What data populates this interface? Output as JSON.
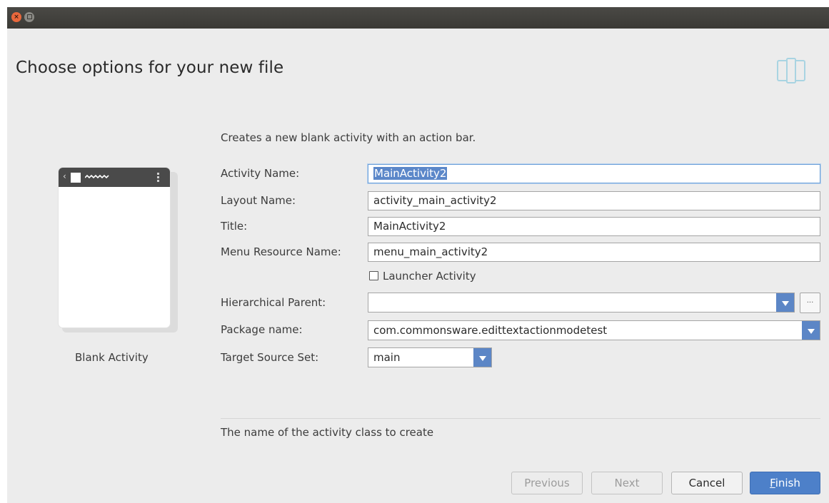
{
  "dialog": {
    "heading": "Choose options for your new file",
    "description": "Creates a new blank activity with an action bar.",
    "hint": "The name of the activity class to create"
  },
  "template": {
    "label": "Blank Activity"
  },
  "form": {
    "activity_name": {
      "label": "Activity Name:",
      "value": "MainActivity2"
    },
    "layout_name": {
      "label": "Layout Name:",
      "value": "activity_main_activity2"
    },
    "title": {
      "label": "Title:",
      "value": "MainActivity2"
    },
    "menu_resource_name": {
      "label": "Menu Resource Name:",
      "value": "menu_main_activity2"
    },
    "launcher_activity": {
      "label": "Launcher Activity",
      "checked": false
    },
    "hierarchical_parent": {
      "label": "Hierarchical Parent:",
      "value": "",
      "browse_label": "..."
    },
    "package_name": {
      "label": "Package name:",
      "value": "com.commonsware.edittextactionmodetest"
    },
    "target_source_set": {
      "label": "Target Source Set:",
      "value": "main"
    }
  },
  "buttons": {
    "previous": "Previous",
    "next": "Next",
    "cancel": "Cancel",
    "finish_mnemonic": "F",
    "finish_rest": "inish"
  },
  "colors": {
    "accent": "#4d80c9",
    "titlebar": "#3b3a36",
    "close": "#e9683c"
  }
}
